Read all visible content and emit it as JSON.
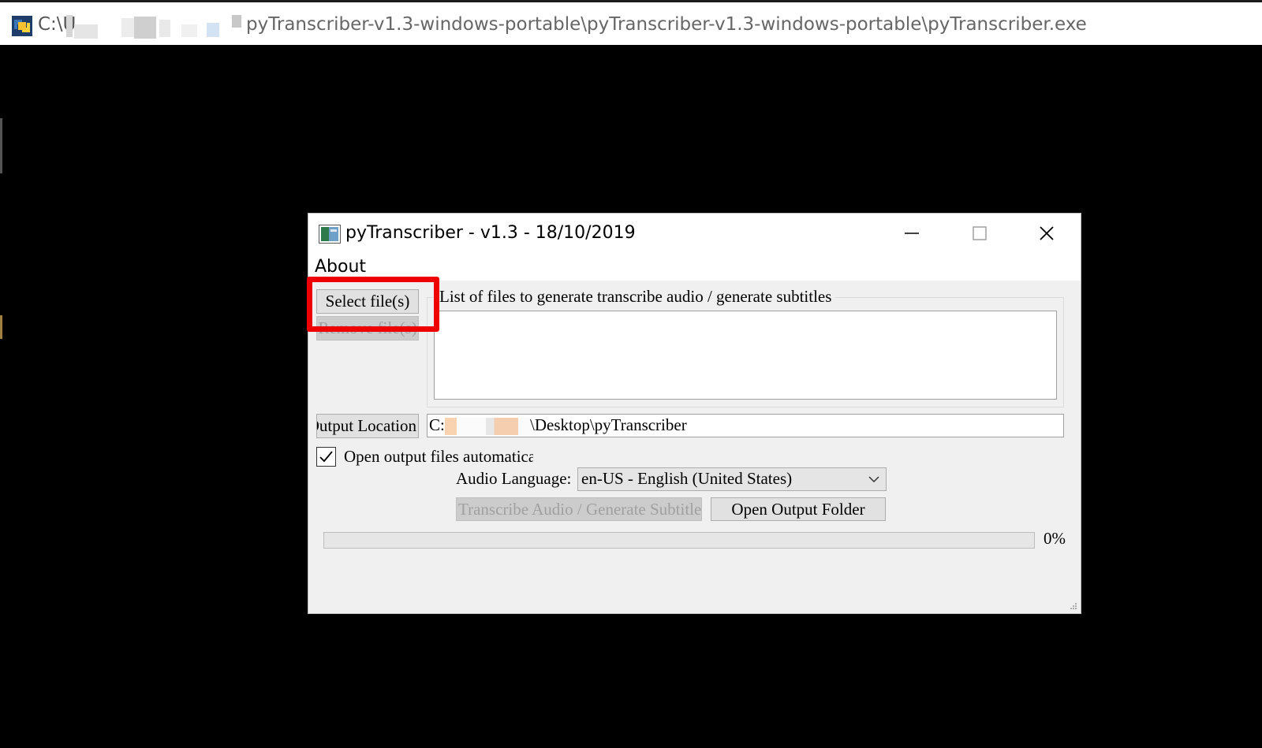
{
  "console": {
    "path_prefix": "C:\\U",
    "path_suffix": "pyTranscriber-v1.3-windows-portable\\pyTranscriber-v1.3-windows-portable\\pyTranscriber.exe",
    "icon": "python-console-icon"
  },
  "window": {
    "title": "pyTranscriber - v1.3 - 18/10/2019",
    "icon": "app-window-icon",
    "controls": [
      "minimize-icon",
      "maximize-icon",
      "close-icon"
    ]
  },
  "menu": {
    "items": [
      {
        "label": "About"
      }
    ]
  },
  "file_panel": {
    "select_label": "Select file(s)",
    "remove_label": "Remove file(s)",
    "group_title": "List of files to generate transcribe audio / generate subtitles"
  },
  "output": {
    "button_label": "Output Location",
    "path_prefix": "C:",
    "path_suffix": "\\Desktop\\pyTranscriber"
  },
  "options": {
    "open_auto_label": "Open output files automatically",
    "open_auto_checked": true,
    "language_label": "Audio Language:",
    "language_value": "en-US - English (United States)"
  },
  "actions": {
    "transcribe_label": "Transcribe Audio / Generate Subtitles",
    "open_folder_label": "Open Output Folder"
  },
  "progress": {
    "value": 0,
    "text": "0%"
  },
  "colors": {
    "highlight": "#ef0000",
    "dialog_bg": "#f0f0f0",
    "console_bg": "#000000"
  }
}
